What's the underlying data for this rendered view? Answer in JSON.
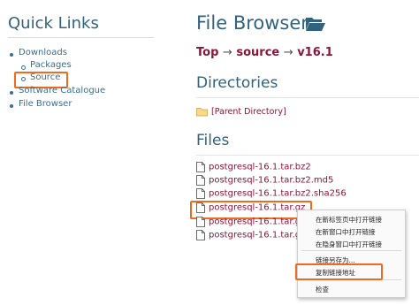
{
  "quick_links": {
    "title": "Quick Links",
    "items": [
      {
        "label": "Downloads",
        "level": 0
      },
      {
        "label": "Packages",
        "level": 1
      },
      {
        "label": "Source",
        "level": 1,
        "highlighted": true
      },
      {
        "label": "Software Catalogue",
        "level": 0
      },
      {
        "label": "File Browser",
        "level": 0
      }
    ]
  },
  "main": {
    "title": "File Browser",
    "title_icon": "open-folder-icon",
    "breadcrumb": [
      "Top",
      "source",
      "v16.1"
    ],
    "breadcrumb_separator": "→",
    "directories_heading": "Directories",
    "parent_directory": "[Parent Directory]",
    "files_heading": "Files",
    "files": [
      "postgresql-16.1.tar.bz2",
      "postgresql-16.1.tar.bz2.md5",
      "postgresql-16.1.tar.bz2.sha256",
      "postgresql-16.1.tar.gz",
      "postgresql-16.1.tar.gz",
      "postgresql-16.1.tar.gz"
    ],
    "files_display": [
      "postgresql-16.1.tar.bz2",
      "postgresql-16.1.tar.bz2.md5",
      "postgresql-16.1.tar.bz2.sha256",
      "postgresql-16.1.tar.gz",
      "postgresql-16.1.tar.gz",
      "postgresql-16.1.tar.gz"
    ]
  },
  "context_menu": {
    "items": [
      "在新标签页中打开链接",
      "在新窗口中打开链接",
      "在隐身窗口中打开链接",
      "链接另存为...",
      "复制链接地址",
      "检查"
    ],
    "highlighted_index": 4
  },
  "colors": {
    "heading": "#33627c",
    "link": "#8a1538",
    "highlight_box": "#f06b1f"
  }
}
